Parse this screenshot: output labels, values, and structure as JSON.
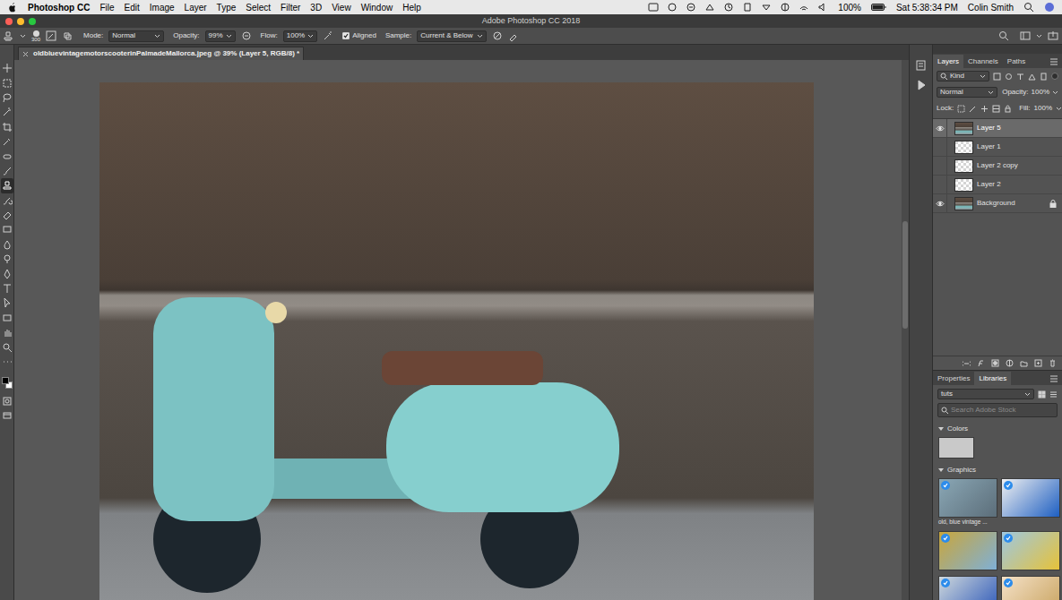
{
  "menu_bar": {
    "app": "Photoshop CC",
    "items": [
      "File",
      "Edit",
      "Image",
      "Layer",
      "Type",
      "Select",
      "Filter",
      "3D",
      "View",
      "Window",
      "Help"
    ],
    "battery": "100%",
    "clock": "Sat 5:38:34 PM",
    "user": "Colin Smith"
  },
  "window": {
    "title": "Adobe Photoshop CC 2018"
  },
  "options_bar": {
    "brush_size": "300",
    "mode_label": "Mode:",
    "mode": "Normal",
    "opacity_label": "Opacity:",
    "opacity": "99%",
    "flow_label": "Flow:",
    "flow": "100%",
    "aligned": {
      "label": "Aligned",
      "checked": true
    },
    "sample_label": "Sample:",
    "sample": "Current & Below"
  },
  "toolbar": {
    "tools": [
      {
        "selected": false
      },
      {
        "selected": false
      },
      {
        "selected": false
      },
      {
        "selected": false
      },
      {
        "selected": false
      },
      {
        "selected": false
      },
      {
        "selected": false
      },
      {
        "selected": false
      },
      {
        "selected": true
      },
      {
        "selected": false
      },
      {
        "selected": false
      },
      {
        "selected": false
      },
      {
        "selected": false
      },
      {
        "selected": false
      },
      {
        "selected": false
      },
      {
        "selected": false
      },
      {
        "selected": false
      },
      {
        "selected": false
      },
      {
        "selected": false
      },
      {
        "selected": false
      },
      {
        "selected": false
      }
    ],
    "foreground": "#000000",
    "background": "#ffffff"
  },
  "document": {
    "tab": "oldbluevintagemotorscooterinPalmadeMallorca.jpeg @ 39% (Layer 5, RGB/8) *"
  },
  "layers_panel": {
    "tabs": [
      {
        "label": "Layers",
        "selected": true
      },
      {
        "label": "Channels",
        "selected": false
      },
      {
        "label": "Paths",
        "selected": false
      }
    ],
    "filter": "Kind",
    "blend_mode": "Normal",
    "opacity_label": "Opacity:",
    "opacity": "100%",
    "lock_label": "Lock:",
    "fill_label": "Fill:",
    "fill": "100%",
    "layers": [
      {
        "name": "Layer 5",
        "visible": true,
        "selected": true,
        "locked": false,
        "kind": "image"
      },
      {
        "name": "Layer 1",
        "visible": false,
        "selected": false,
        "locked": false,
        "kind": "transparent"
      },
      {
        "name": "Layer 2 copy",
        "visible": false,
        "selected": false,
        "locked": false,
        "kind": "transparent"
      },
      {
        "name": "Layer 2",
        "visible": false,
        "selected": false,
        "locked": false,
        "kind": "transparent"
      },
      {
        "name": "Background",
        "visible": true,
        "selected": false,
        "locked": true,
        "kind": "image"
      }
    ]
  },
  "libraries_panel": {
    "tabs": [
      {
        "label": "Properties",
        "selected": false
      },
      {
        "label": "Libraries",
        "selected": true
      }
    ],
    "library": "tuts",
    "search": {
      "placeholder": "Search Adobe Stock"
    },
    "colors_section": {
      "label": "Colors",
      "expanded": true
    },
    "colors": [
      {
        "color": "#c9c9c9"
      }
    ],
    "graphics_section": {
      "label": "Graphics",
      "expanded": true
    },
    "graphics": [
      {
        "label": "old, blue vintage ...",
        "checked": true
      },
      {
        "label": "",
        "checked": true
      },
      {
        "label": "",
        "checked": true
      },
      {
        "label": "",
        "checked": true
      },
      {
        "label": "",
        "checked": true
      },
      {
        "label": "",
        "checked": true
      }
    ]
  }
}
